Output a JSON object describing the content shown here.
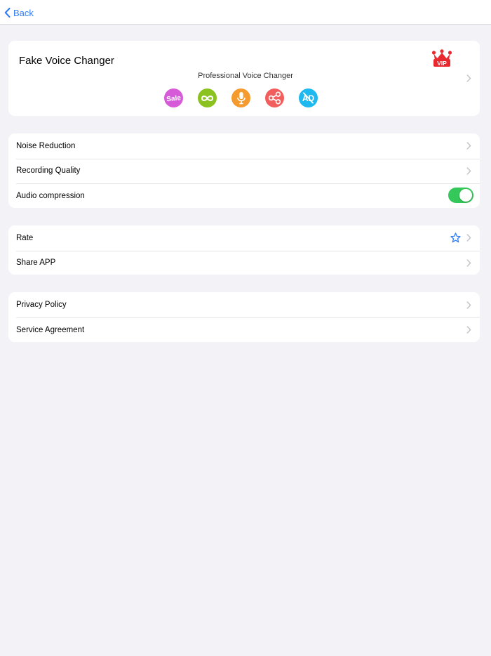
{
  "navbar": {
    "back_label": "Back"
  },
  "app": {
    "title": "Fake Voice Changer",
    "subtitle": "Professional Voice Changer",
    "vip_label": "VIP",
    "features": [
      {
        "icon": "sale-icon",
        "label": "Sale",
        "color": "#d65bd8"
      },
      {
        "icon": "infinity-icon",
        "color": "#8cc21f"
      },
      {
        "icon": "microphone-icon",
        "color": "#f59a2e"
      },
      {
        "icon": "share-icon",
        "color": "#f25e5e"
      },
      {
        "icon": "no-ads-icon",
        "label": "AD",
        "color": "#1fb8ef"
      }
    ]
  },
  "settings_group": {
    "items": [
      {
        "label": "Noise Reduction"
      },
      {
        "label": "Recording Quality"
      },
      {
        "label": "Audio compression",
        "toggle_on": true
      }
    ]
  },
  "feedback_group": {
    "items": [
      {
        "label": "Rate",
        "icon": "star-icon"
      },
      {
        "label": "Share APP"
      }
    ]
  },
  "legal_group": {
    "items": [
      {
        "label": "Privacy Policy"
      },
      {
        "label": "Service Agreement"
      }
    ]
  },
  "colors": {
    "accent": "#2f7cf6",
    "toggle_on": "#34c759",
    "vip_red": "#e8292f",
    "background": "#f2f2f7"
  }
}
